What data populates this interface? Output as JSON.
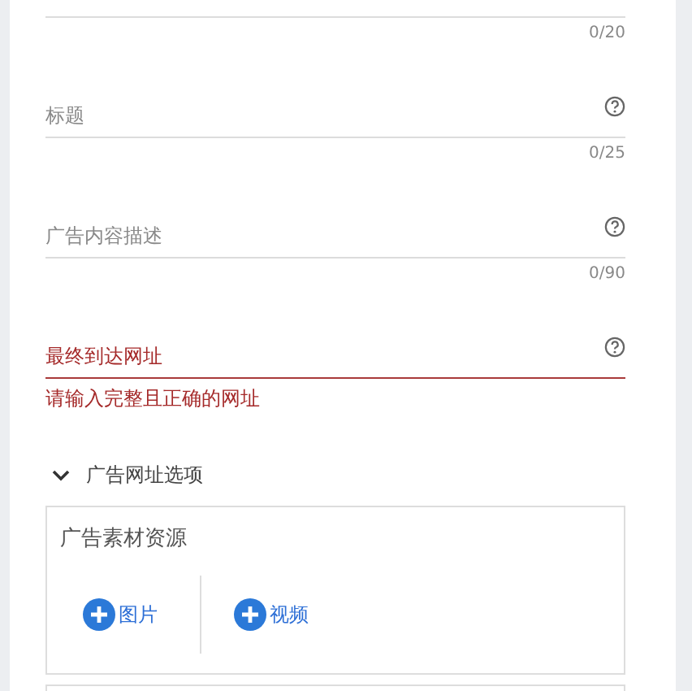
{
  "fields": [
    {
      "counter": "0/20",
      "error": false
    },
    {
      "label": "标题",
      "help": true,
      "counter": "0/25",
      "error": false
    },
    {
      "label": "广告内容描述",
      "help": true,
      "counter": "0/90",
      "error": false
    },
    {
      "label": "最终到达网址",
      "help": true,
      "error": true,
      "error_text": "请输入完整且正确的网址"
    }
  ],
  "url_options": {
    "label": "广告网址选项",
    "expanded": true
  },
  "assets": {
    "title": "广告素材资源",
    "buttons": [
      {
        "label": "图片"
      },
      {
        "label": "视频"
      }
    ]
  }
}
